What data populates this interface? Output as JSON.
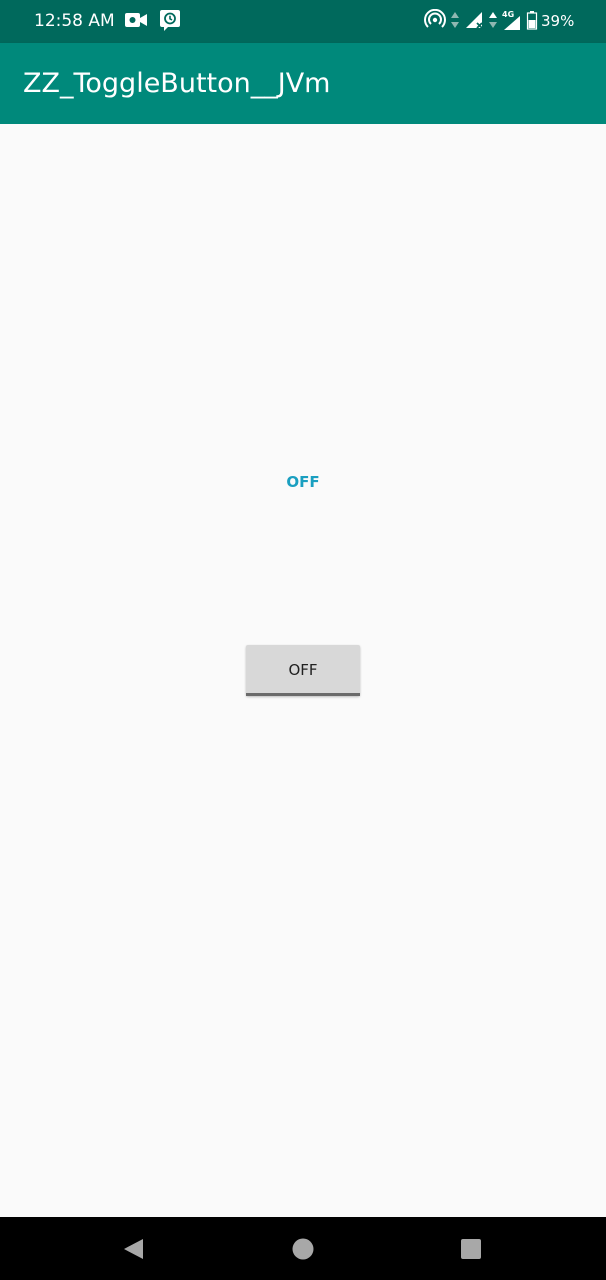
{
  "status_bar": {
    "time": "12:58 AM",
    "battery_percent": "39%",
    "left_icons": [
      "video-camera-icon",
      "alarm-icon"
    ],
    "right_icons": [
      "hotspot-icon",
      "data-arrows-icon",
      "signal-no-data-icon",
      "4g-signal-icon",
      "battery-icon"
    ],
    "network_label": "4G"
  },
  "app_bar": {
    "title": "ZZ_ToggleButton__JVm"
  },
  "main": {
    "state_text": "OFF",
    "toggle_button": {
      "label": "OFF",
      "checked": false
    }
  },
  "nav_bar": {
    "buttons": [
      "back-icon",
      "home-icon",
      "recents-icon"
    ]
  },
  "colors": {
    "status_bar": "#00695c",
    "app_bar": "#00897b",
    "state_text": "#1a9fc0",
    "button_bg": "#d8d8d8",
    "background": "#fafafa"
  }
}
